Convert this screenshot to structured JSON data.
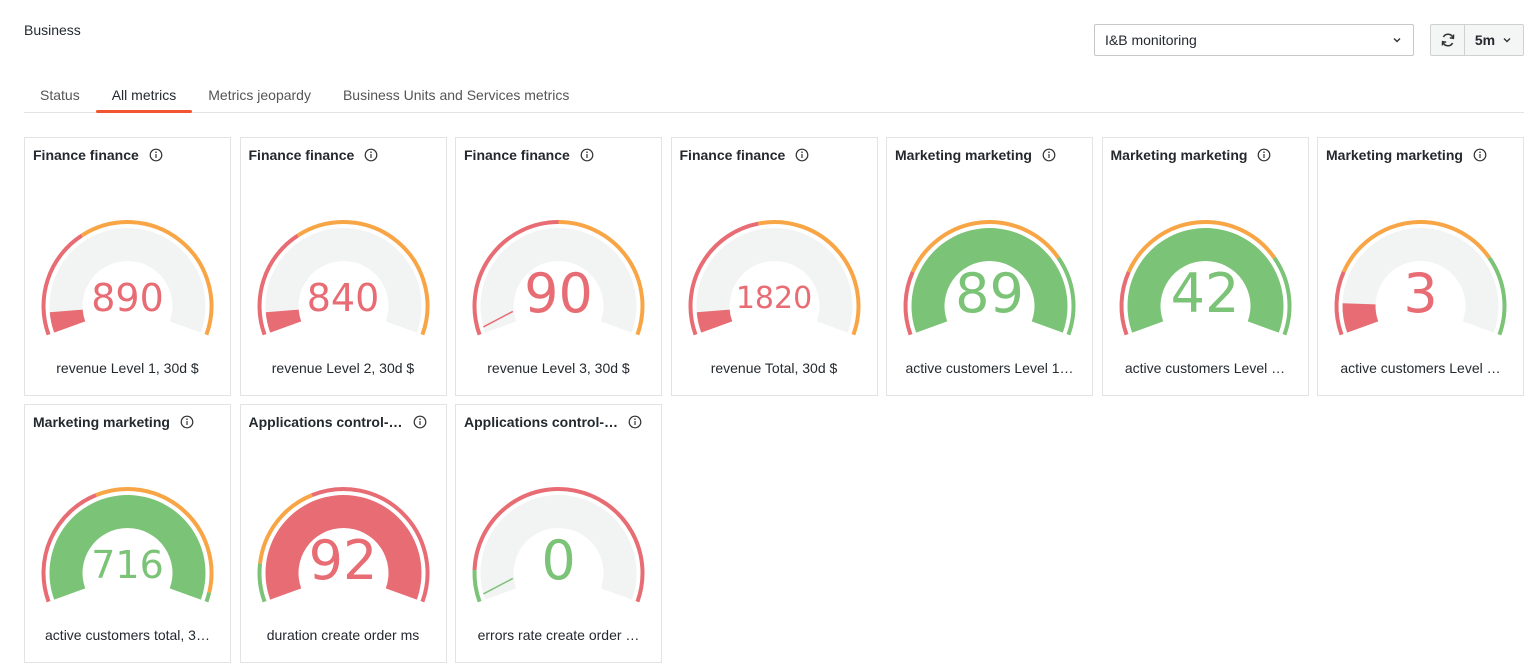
{
  "page": {
    "title": "Business"
  },
  "dashboard_select": {
    "value": "I&B monitoring"
  },
  "toolbar": {
    "interval": "5m"
  },
  "tabs": [
    {
      "label": "Status",
      "active": false
    },
    {
      "label": "All metrics",
      "active": true
    },
    {
      "label": "Metrics jeopardy",
      "active": false
    },
    {
      "label": "Business Units and Services metrics",
      "active": false
    }
  ],
  "colors": {
    "red": "#e86c73",
    "orange": "#f8a546",
    "green": "#7bc376",
    "track": "#f2f3f3",
    "accent": "#f0552f"
  },
  "cards": [
    {
      "title": "Finance finance",
      "value": "890",
      "caption": "revenue Level 1, 30d $",
      "fill": 0.07,
      "fill_color": "red",
      "value_color": "red",
      "thresholds": [
        {
          "upto": 0.35,
          "color": "red"
        },
        {
          "upto": 1.0,
          "color": "orange"
        }
      ]
    },
    {
      "title": "Finance finance",
      "value": "840",
      "caption": "revenue Level 2, 30d $",
      "fill": 0.07,
      "fill_color": "red",
      "value_color": "red",
      "thresholds": [
        {
          "upto": 0.35,
          "color": "red"
        },
        {
          "upto": 1.0,
          "color": "orange"
        }
      ]
    },
    {
      "title": "Finance finance",
      "value": "90",
      "caption": "revenue Level 3, 30d $",
      "fill": 0.0,
      "fill_color": "red",
      "value_color": "red",
      "thresholds": [
        {
          "upto": 0.5,
          "color": "red"
        },
        {
          "upto": 1.0,
          "color": "orange"
        }
      ]
    },
    {
      "title": "Finance finance",
      "value": "1820",
      "caption": "revenue Total, 30d $",
      "fill": 0.07,
      "fill_color": "red",
      "value_color": "red",
      "thresholds": [
        {
          "upto": 0.45,
          "color": "red"
        },
        {
          "upto": 1.0,
          "color": "orange"
        }
      ]
    },
    {
      "title": "Marketing marketing",
      "value": "89",
      "caption": "active customers Level 1…",
      "fill": 1.0,
      "fill_color": "green",
      "value_color": "green",
      "thresholds": [
        {
          "upto": 0.2,
          "color": "red"
        },
        {
          "upto": 0.75,
          "color": "orange"
        },
        {
          "upto": 1.0,
          "color": "green"
        }
      ]
    },
    {
      "title": "Marketing marketing",
      "value": "42",
      "caption": "active customers Level …",
      "fill": 1.0,
      "fill_color": "green",
      "value_color": "green",
      "thresholds": [
        {
          "upto": 0.2,
          "color": "red"
        },
        {
          "upto": 0.75,
          "color": "orange"
        },
        {
          "upto": 1.0,
          "color": "green"
        }
      ]
    },
    {
      "title": "Marketing marketing",
      "value": "3",
      "caption": "active customers Level …",
      "fill": 0.1,
      "fill_color": "red",
      "value_color": "red",
      "thresholds": [
        {
          "upto": 0.2,
          "color": "red"
        },
        {
          "upto": 0.75,
          "color": "orange"
        },
        {
          "upto": 1.0,
          "color": "green"
        }
      ]
    },
    {
      "title": "Marketing marketing",
      "value": "716",
      "caption": "active customers total, 3…",
      "fill": 1.0,
      "fill_color": "green",
      "value_color": "green",
      "thresholds": [
        {
          "upto": 0.4,
          "color": "red"
        },
        {
          "upto": 0.97,
          "color": "orange"
        },
        {
          "upto": 1.0,
          "color": "green"
        }
      ]
    },
    {
      "title": "Applications control-…",
      "value": "92",
      "caption": "duration create order ms",
      "fill": 1.0,
      "fill_color": "red",
      "value_color": "red",
      "thresholds": [
        {
          "upto": 0.12,
          "color": "green"
        },
        {
          "upto": 0.4,
          "color": "orange"
        },
        {
          "upto": 1.0,
          "color": "red"
        }
      ]
    },
    {
      "title": "Applications control-…",
      "value": "0",
      "caption": "errors rate create order …",
      "fill": 0.0,
      "fill_color": "green",
      "value_color": "green",
      "thresholds": [
        {
          "upto": 0.1,
          "color": "green"
        },
        {
          "upto": 1.0,
          "color": "red"
        }
      ]
    }
  ]
}
